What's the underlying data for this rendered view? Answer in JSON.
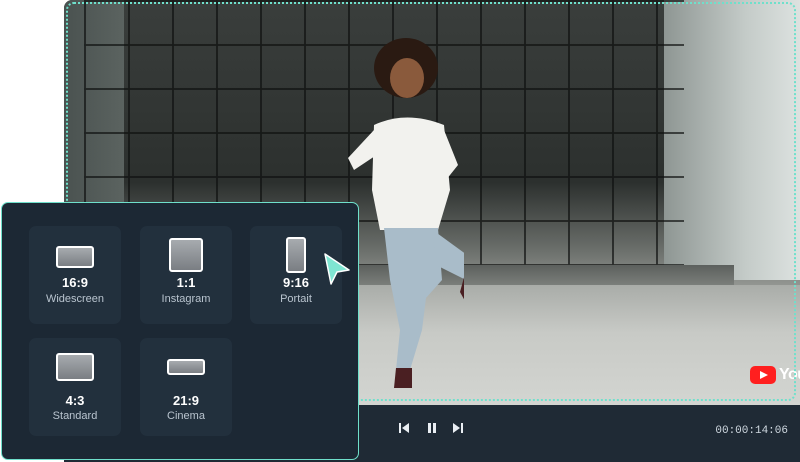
{
  "ratios": [
    {
      "ratio": "16:9",
      "label": "Widescreen"
    },
    {
      "ratio": "1:1",
      "label": "Instagram"
    },
    {
      "ratio": "9:16",
      "label": "Portait"
    },
    {
      "ratio": "4:3",
      "label": "Standard"
    },
    {
      "ratio": "21:9",
      "label": "Cinema"
    }
  ],
  "player": {
    "watermark": "YouTube",
    "timestamp": "00:00:14:06",
    "icons": [
      "skip-back-icon",
      "pause-icon",
      "skip-forward-icon"
    ]
  },
  "colors": {
    "accent": "#6fe0cb",
    "panel_bg": "#1c2834",
    "card_bg": "#22303d",
    "controls_bg": "#1f2a35",
    "youtube_red": "#ff1f1f"
  }
}
